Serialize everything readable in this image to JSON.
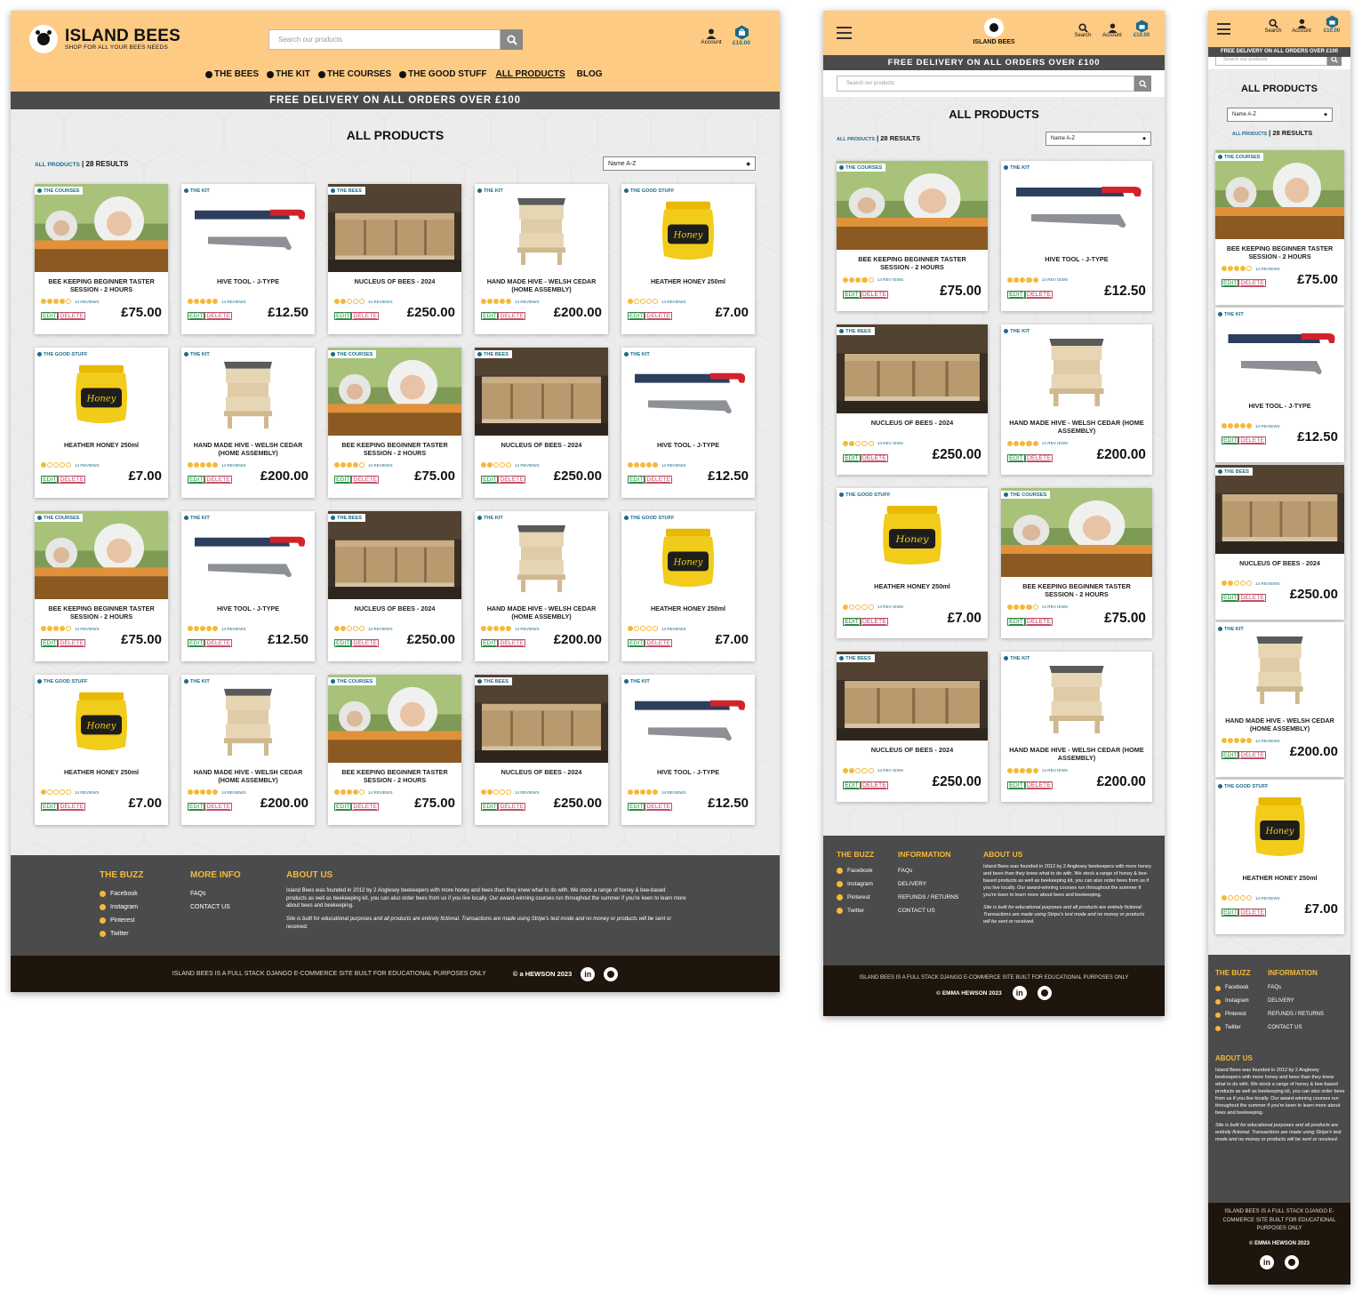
{
  "brand": {
    "name": "ISLAND BEES",
    "tagline": "SHOP FOR ALL YOUR BEES NEEDS"
  },
  "search": {
    "placeholder": "Search our products",
    "label": "Search"
  },
  "account": {
    "label": "Account"
  },
  "basket": {
    "total": "£10.00"
  },
  "nav": [
    {
      "label": "THE BEES"
    },
    {
      "label": "THE KIT"
    },
    {
      "label": "THE COURSES"
    },
    {
      "label": "THE GOOD STUFF"
    },
    {
      "label": "ALL PRODUCTS"
    },
    {
      "label": "BLOG"
    }
  ],
  "banner": "FREE DELIVERY ON ALL ORDERS OVER £100",
  "page_title": "ALL PRODUCTS",
  "results": {
    "link": "ALL PRODUCTS",
    "sep": " | ",
    "count": "28 RESULTS"
  },
  "sort": {
    "selected": "Name A-Z"
  },
  "buttons": {
    "edit": "EDIT",
    "delete": "DELETE"
  },
  "products": {
    "courses": {
      "category": "THE COURSES",
      "name": "BEE KEEPING BEGINNER TASTER SESSION - 2 HOURS",
      "rating": 4,
      "reviews": "14 REVIEWS",
      "price": "£75.00"
    },
    "tool": {
      "category": "THE KIT",
      "name": "HIVE TOOL - J-TYPE",
      "rating": 5,
      "reviews": "14 REVIEWS",
      "price": "£12.50"
    },
    "bees": {
      "category": "THE BEES",
      "name": "NUCLEUS OF BEES - 2024",
      "rating": 2,
      "reviews": "14 REVIEWS",
      "price": "£250.00"
    },
    "hive": {
      "category": "THE KIT",
      "name": "HAND MADE HIVE - WELSH CEDAR (HOME ASSEMBLY)",
      "rating": 5,
      "reviews": "14 REVIEWS",
      "price": "£200.00"
    },
    "honey": {
      "category": "THE GOOD STUFF",
      "name": "HEATHER HONEY 250ml",
      "rating": 1,
      "reviews": "14 REVIEWS",
      "price": "£7.00"
    }
  },
  "tablet_reviews": "14 REV IEWS",
  "honey_label": "Honey",
  "footer": {
    "buzz_title": "THE BUZZ",
    "buzz": [
      "Facebook",
      "Instagram",
      "Pinterest",
      "Twitter"
    ],
    "more_title": "MORE INFO",
    "more": [
      "FAQs",
      "CONTACT US"
    ],
    "info_title": "INFORMATION",
    "info": [
      "FAQs",
      "DELIVERY",
      "REFUNDS / RETURNS",
      "CONTACT US"
    ],
    "about_title": "ABOUT US",
    "about": "Island Bees was founded in 2012 by 2 Anglesey beekeepers with more honey and bees than they knew what to do with. We stock a range of honey & bee-based products as well as beekeeping kit, you can also order bees from us if you live locally. Our award-winning courses run throughout the summer if you're keen to learn more about bees and beekeeping.",
    "disclaimer": "Site is built for educational purposes and all products are entirely fictional. Transactions are made using Stripe's test mode and no money or products will be sent or received.",
    "bottom": "ISLAND BEES IS A FULL STACK DJANGO E-COMMERCE SITE BUILT FOR EDUCATIONAL PURPOSES ONLY",
    "copyright_desk": "© a HEWSON 2023",
    "copyright": "© EMMA HEWSON 2023",
    "linkedin": "in"
  }
}
